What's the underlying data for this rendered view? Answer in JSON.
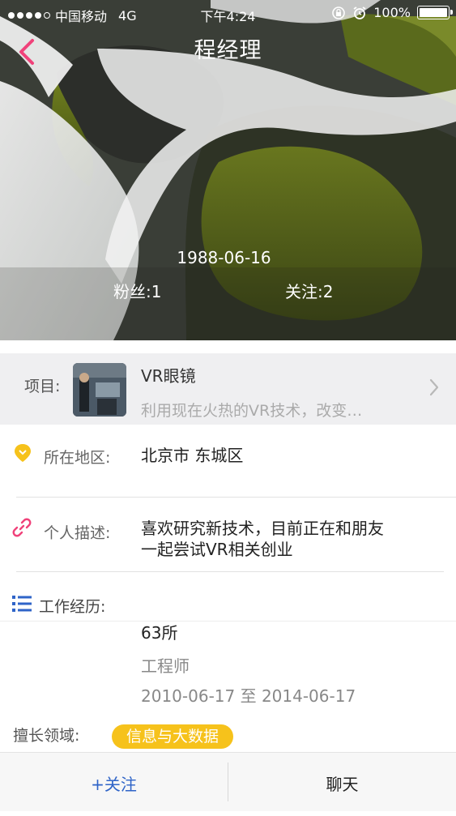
{
  "status_bar": {
    "carrier": "中国移动",
    "network": "4G",
    "time": "下午4:24",
    "battery": "100%"
  },
  "header": {
    "title": "程经理"
  },
  "profile": {
    "birthday": "1988-06-16",
    "fans": "粉丝:1",
    "following": "关注:2"
  },
  "project": {
    "label": "项目:",
    "name": "VR眼镜",
    "description": "利用现在火热的VR技术，改变…"
  },
  "location": {
    "label": "所在地区:",
    "value": "北京市 东城区"
  },
  "description": {
    "label": "个人描述:",
    "line1": "喜欢研究新技术，目前正在和朋友",
    "line2": "一起尝试VR相关创业"
  },
  "work": {
    "label": "工作经历:",
    "company": "63所",
    "position": "工程师",
    "period": "2010-06-17 至 2014-06-17"
  },
  "expertise": {
    "label": "擅长领域:",
    "tag": "信息与大数据"
  },
  "bottom_bar": {
    "follow": "+关注",
    "chat": "聊天"
  },
  "colors": {
    "accent_pink": "#f0427a",
    "location_yellow": "#f6c21b",
    "list_blue": "#2f64c8",
    "tag_yellow": "#f6c21b"
  },
  "icons": [
    "back-chevron-icon",
    "alarm-icon",
    "lock-rotation-icon",
    "location-pin-icon",
    "link-icon",
    "list-icon",
    "chevron-right-icon"
  ]
}
